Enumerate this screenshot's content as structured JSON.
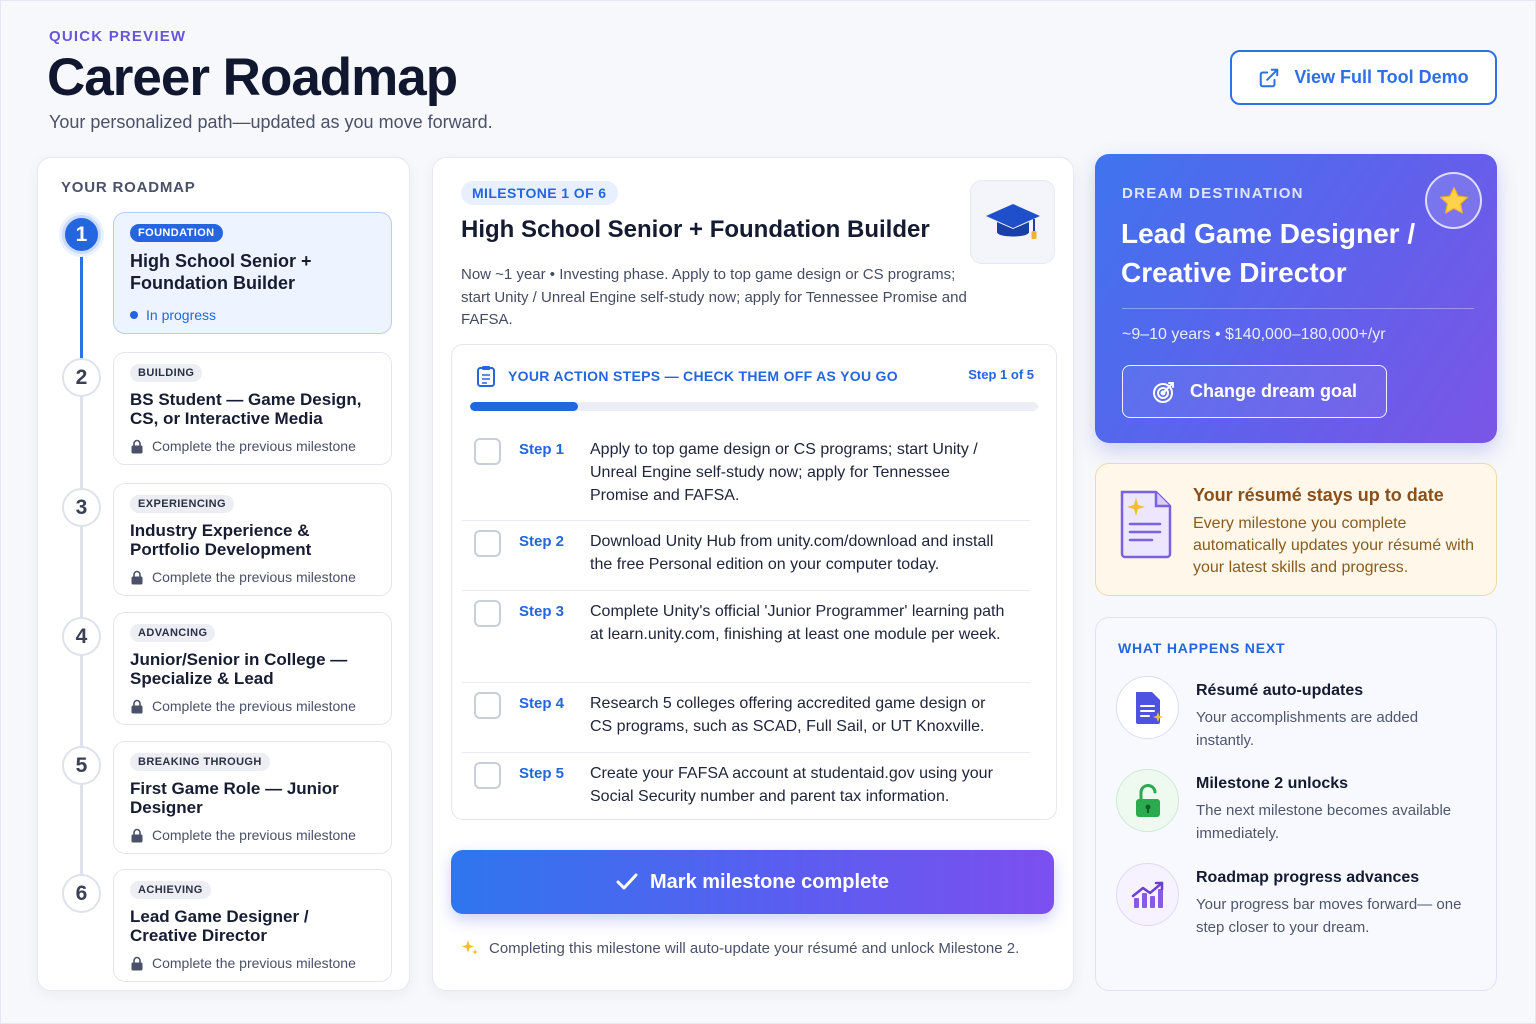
{
  "header": {
    "eyebrow": "QUICK PREVIEW",
    "title": "Career Roadmap",
    "subtitle": "Your personalized path—updated as you move forward.",
    "demo_button": "View Full Tool Demo"
  },
  "roadmap": {
    "heading": "YOUR ROADMAP",
    "items": [
      {
        "number": "1",
        "tag": "FOUNDATION",
        "title": "High School Senior + Foundation Builder",
        "status": "In progress",
        "active": true
      },
      {
        "number": "2",
        "tag": "BUILDING",
        "title": "BS Student — Game Design, CS, or Interactive Media",
        "status": "Complete the previous milestone",
        "active": false
      },
      {
        "number": "3",
        "tag": "EXPERIENCING",
        "title": "Industry Experience & Portfolio Development",
        "status": "Complete the previous milestone",
        "active": false
      },
      {
        "number": "4",
        "tag": "ADVANCING",
        "title": "Junior/Senior in College — Specialize & Lead",
        "status": "Complete the previous milestone",
        "active": false
      },
      {
        "number": "5",
        "tag": "BREAKING THROUGH",
        "title": "First Game Role — Junior Designer",
        "status": "Complete the previous milestone",
        "active": false
      },
      {
        "number": "6",
        "tag": "ACHIEVING",
        "title": "Lead Game Designer / Creative Director",
        "status": "Complete the previous milestone",
        "active": false
      }
    ]
  },
  "milestone": {
    "badge": "MILESTONE 1 OF 6",
    "title": "High School Senior + Foundation Builder",
    "description": "Now ~1 year • Investing phase. Apply to top game design or CS programs; start Unity / Unreal Engine self-study now; apply for Tennessee Promise and FAFSA.",
    "steps_header": "YOUR ACTION STEPS — CHECK THEM OFF AS YOU GO",
    "steps_count": "Step 1 of 5",
    "progress_fraction": 0.19,
    "steps": [
      {
        "label": "Step 1",
        "text": "Apply to top game design or CS programs; start Unity / Unreal Engine self-study now; apply for Tennessee Promise and FAFSA.",
        "checked": false
      },
      {
        "label": "Step 2",
        "text": "Download Unity Hub from unity.com/download and install the free Personal edition on your computer today.",
        "checked": false
      },
      {
        "label": "Step 3",
        "text": "Complete Unity's official 'Junior Programmer' learning path at learn.unity.com, finishing at least one module per week.",
        "checked": false
      },
      {
        "label": "Step 4",
        "text": "Research 5 colleges offering accredited game design or CS programs, such as SCAD, Full Sail, or UT Knoxville.",
        "checked": false
      },
      {
        "label": "Step 5",
        "text": "Create your FAFSA account at studentaid.gov using your Social Security number and parent tax information.",
        "checked": false
      }
    ],
    "complete_button": "Mark milestone complete",
    "complete_note": "Completing this milestone will auto-update your résumé and unlock Milestone 2."
  },
  "dream": {
    "eyebrow": "DREAM DESTINATION",
    "title": "Lead Game Designer / Creative Director",
    "meta": "~9–10 years • $140,000–180,000+/yr",
    "change_button": "Change dream goal"
  },
  "resume": {
    "title": "Your résumé stays up to date",
    "text": "Every milestone you complete automatically updates your résumé with your latest skills and progress."
  },
  "next": {
    "heading": "WHAT HAPPENS NEXT",
    "items": [
      {
        "icon": "document-sparkle-icon",
        "title": "Résumé auto-updates",
        "text": "Your accomplishments are added instantly."
      },
      {
        "icon": "unlock-icon",
        "title": "Milestone 2 unlocks",
        "text": "The next milestone becomes available immediately."
      },
      {
        "icon": "chart-trend-up-icon",
        "title": "Roadmap progress advances",
        "text": "Your progress bar moves forward— one step closer to your dream."
      }
    ]
  },
  "colors": {
    "accent": "#2366e0",
    "brand_purple": "#6a55d8",
    "warm_bg": "#fff8ea",
    "warm_text": "#8a4f1a"
  }
}
